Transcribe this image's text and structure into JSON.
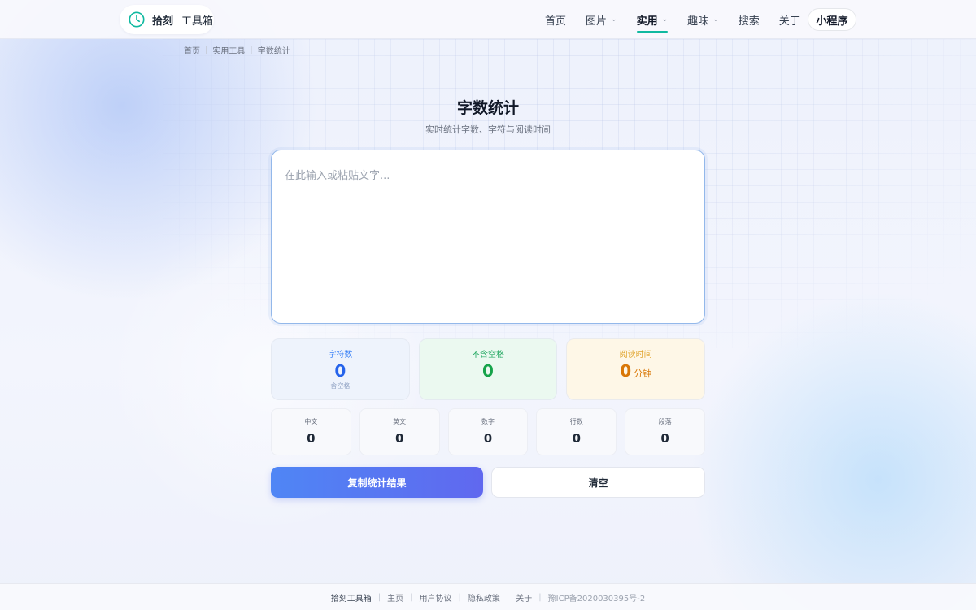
{
  "header": {
    "logo_name": "拾刻",
    "logo_sub": "工具箱",
    "nav": [
      {
        "label": "首页",
        "chevron": false,
        "active": false
      },
      {
        "label": "图片",
        "chevron": true,
        "active": false
      },
      {
        "label": "实用",
        "chevron": true,
        "active": true
      },
      {
        "label": "趣味",
        "chevron": true,
        "active": false
      },
      {
        "label": "搜索",
        "chevron": false,
        "active": false
      },
      {
        "label": "关于",
        "chevron": false,
        "active": false
      }
    ],
    "mini_program": "小程序"
  },
  "breadcrumb": [
    "首页",
    "实用工具",
    "字数统计"
  ],
  "page": {
    "title": "字数统计",
    "subtitle": "实时统计字数、字符与阅读时间"
  },
  "input": {
    "placeholder": "在此输入或粘贴文字...",
    "value": ""
  },
  "stats": {
    "chars": {
      "label": "字符数",
      "value": "0",
      "note": "含空格"
    },
    "no_space": {
      "label": "不含空格",
      "value": "0"
    },
    "reading": {
      "label": "阅读时间",
      "value": "0",
      "unit": "分钟"
    }
  },
  "details": [
    {
      "label": "中文",
      "value": "0"
    },
    {
      "label": "英文",
      "value": "0"
    },
    {
      "label": "数字",
      "value": "0"
    },
    {
      "label": "行数",
      "value": "0"
    },
    {
      "label": "段落",
      "value": "0"
    }
  ],
  "actions": {
    "copy": "复制统计结果",
    "clear": "清空"
  },
  "footer": {
    "brand": "拾刻工具箱",
    "links": [
      "主页",
      "用户协议",
      "隐私政策",
      "关于"
    ],
    "icp": "豫ICP备2020030395号-2"
  },
  "colors": {
    "accent": "#10b9a0",
    "primary_start": "#4f86f5",
    "primary_end": "#6068ef",
    "blue": "#2563eb",
    "green": "#16a34a",
    "orange": "#d97706"
  },
  "icons": {
    "logo": "clock-icon",
    "nav_chevron": "chevron-down-icon"
  }
}
